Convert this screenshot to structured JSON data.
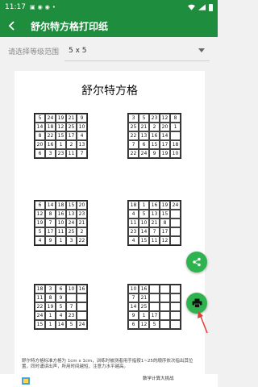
{
  "status_bar": {
    "time": "11:17"
  },
  "app_bar": {
    "title": "舒尔特方格打印纸"
  },
  "level_selector": {
    "label": "请选择等级范围",
    "value": "5 x 5"
  },
  "paper": {
    "title": "舒尔特方格",
    "grids": [
      [
        [
          5,
          24,
          19,
          21,
          9
        ],
        [
          14,
          18,
          12,
          25,
          10
        ],
        [
          8,
          22,
          15,
          17,
          4
        ],
        [
          20,
          16,
          1,
          2,
          13
        ],
        [
          6,
          3,
          23,
          11,
          7
        ]
      ],
      [
        [
          3,
          5,
          23,
          12,
          8
        ],
        [
          25,
          21,
          2,
          20,
          1
        ],
        [
          22,
          13,
          16,
          14,
          ""
        ],
        [
          7,
          6,
          15,
          17,
          18
        ],
        [
          22,
          24,
          9,
          19,
          10
        ]
      ],
      [
        [
          6,
          14,
          18,
          15,
          20
        ],
        [
          12,
          8,
          16,
          13,
          23
        ],
        [
          19,
          7,
          10,
          24,
          21
        ],
        [
          5,
          17,
          11,
          25,
          2
        ],
        [
          4,
          9,
          1,
          3,
          22
        ]
      ],
      [
        [
          18,
          1,
          16,
          19,
          24
        ],
        [
          4,
          5,
          13,
          15,
          ""
        ],
        [
          11,
          10,
          21,
          8,
          ""
        ],
        [
          23,
          14,
          7,
          17,
          ""
        ],
        [
          4,
          15,
          11,
          12,
          ""
        ]
      ],
      [
        [
          18,
          3,
          6,
          10,
          16
        ],
        [
          11,
          8,
          9,
          "",
          ""
        ],
        [
          22,
          19,
          5,
          7,
          ""
        ],
        [
          24,
          1,
          4,
          23,
          ""
        ],
        [
          15,
          1,
          14,
          5,
          24
        ]
      ],
      [
        [
          10,
          16,
          "",
          "",
          ""
        ],
        [
          7,
          21,
          "",
          "",
          ""
        ],
        [
          14,
          25,
          "",
          "",
          ""
        ],
        [
          9,
          1,
          17,
          "",
          ""
        ],
        [
          6,
          12,
          5,
          "",
          ""
        ]
      ]
    ],
    "footer": "舒尔特方格标准方格为 1cm x 1cm，训练时被测者用手指按1~25的顺序依次指出其位置，同时诵读出声，所用时间越短，注意力水平越高。"
  },
  "bottom_bar": {
    "right_text": "数学计算大挑战"
  },
  "colors": {
    "primary": "#1e8e3e",
    "fab": "#2eb34e",
    "annotation_arrow": "#e53935"
  },
  "icons": {
    "back": "arrow-left-icon",
    "share": "share-icon",
    "print": "print-icon"
  }
}
